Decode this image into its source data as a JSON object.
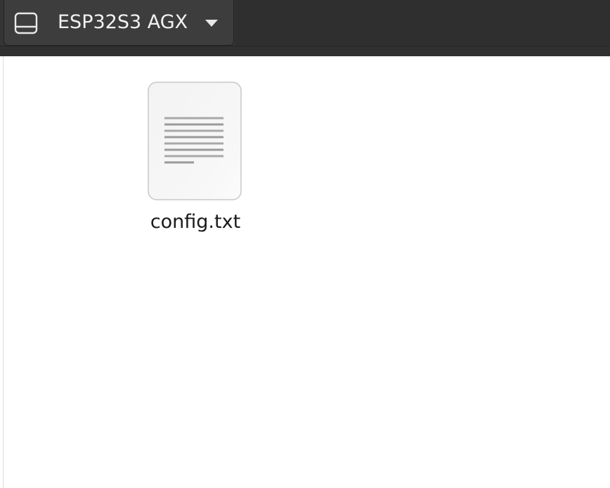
{
  "header": {
    "location_label": "ESP32S3 AGX",
    "location_icon": "drive-icon",
    "dropdown_icon": "chevron-down-icon"
  },
  "files": [
    {
      "name": "config.txt",
      "icon": "text-document-icon"
    }
  ],
  "colors": {
    "header_bg": "#353535",
    "button_bg": "#3d3d3d",
    "content_bg": "#ffffff",
    "label_text": "#f2f2f2"
  }
}
